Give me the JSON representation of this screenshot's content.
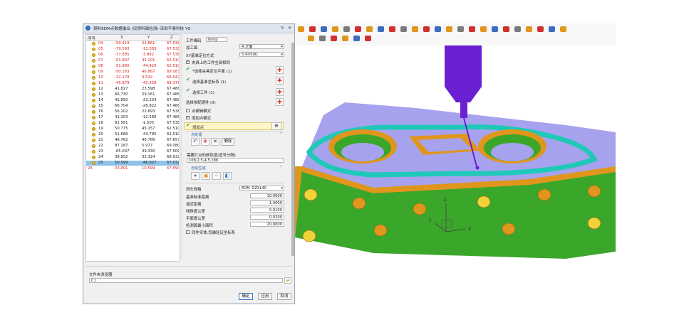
{
  "window": {
    "title": "铜料EDM点数据输出 (仅铜料面检测)-深圳平泰科技 YG"
  },
  "table": {
    "headers": [
      "序号",
      "X",
      "Y",
      "Z"
    ],
    "rows": [
      {
        "n": "",
        "id": "04",
        "x": "-59.419",
        "y": "22.861",
        "z": "67.538",
        "color": "red"
      },
      {
        "n": "",
        "id": "05",
        "x": "-79.593",
        "y": "-11.383",
        "z": "67.538",
        "color": "red"
      },
      {
        "n": "",
        "id": "06",
        "x": "-37.685",
        "y": "-3.882",
        "z": "67.538",
        "color": "red"
      },
      {
        "n": "",
        "id": "07",
        "x": "-51.807",
        "y": "45.101",
        "z": "62.510",
        "color": "red"
      },
      {
        "n": "",
        "id": "08",
        "x": "-51.860",
        "y": "-44.929",
        "z": "62.510",
        "color": "red"
      },
      {
        "n": "",
        "id": "09",
        "x": "-50.163",
        "y": "46.867",
        "z": "68.083",
        "color": "red"
      },
      {
        "n": "",
        "id": "10",
        "x": "-32.178",
        "y": "0.532",
        "z": "68.547",
        "color": "red"
      },
      {
        "n": "",
        "id": "11",
        "x": "-45.879",
        "y": "-45.358",
        "z": "68.378",
        "color": "red"
      },
      {
        "n": "",
        "id": "12",
        "x": "41.827",
        "y": "23.598",
        "z": "67.488",
        "color": "dark"
      },
      {
        "n": "",
        "id": "13",
        "x": "66.730",
        "y": "29.161",
        "z": "67.488",
        "color": "dark"
      },
      {
        "n": "",
        "id": "14",
        "x": "41.850",
        "y": "-23.234",
        "z": "67.488",
        "color": "dark"
      },
      {
        "n": "",
        "id": "15",
        "x": "66.704",
        "y": "-28.822",
        "z": "67.488",
        "color": "dark"
      },
      {
        "n": "",
        "id": "16",
        "x": "56.202",
        "y": "22.693",
        "z": "67.538",
        "color": "dark"
      },
      {
        "n": "",
        "id": "17",
        "x": "41.303",
        "y": "-12.586",
        "z": "67.488",
        "color": "dark"
      },
      {
        "n": "",
        "id": "18",
        "x": "82.581",
        "y": "-1.505",
        "z": "67.538",
        "color": "dark"
      },
      {
        "n": "",
        "id": "19",
        "x": "50.775",
        "y": "45.157",
        "z": "62.510",
        "color": "dark"
      },
      {
        "n": "",
        "id": "20",
        "x": "51.686",
        "y": "-44.785",
        "z": "62.510",
        "color": "dark"
      },
      {
        "n": "",
        "id": "21",
        "x": "48.762",
        "y": "46.786",
        "z": "67.657",
        "color": "dark"
      },
      {
        "n": "",
        "id": "22",
        "x": "87.187",
        "y": "5.977",
        "z": "69.080",
        "color": "dark"
      },
      {
        "n": "",
        "id": "23",
        "x": "-65.037",
        "y": "39.330",
        "z": "67.509",
        "color": "dark"
      },
      {
        "n": "",
        "id": "24",
        "x": "38.852",
        "y": "32.324",
        "z": "68.632",
        "color": "dark"
      },
      {
        "n": "",
        "id": "25",
        "x": "50.599",
        "y": "-46.927",
        "z": "67.032",
        "color": "sel"
      },
      {
        "n": "26",
        "id": "",
        "x": "33.891",
        "y": "10.599",
        "z": "67.890",
        "color": "red"
      }
    ]
  },
  "panel": {
    "workpiece_no_label": "工件编码",
    "workpiece_no_value": "temp",
    "machining_face_label": "加工面",
    "machining_face_value": "A:正面",
    "xy_ref_label": "XY基准定位方式",
    "xy_ref_value": "5:中(5点)",
    "fixture_same_label": "夹具上的工件全部相同",
    "select_fixture_plane": "*选择夹具定位平面 (1)",
    "select_ref_csys": "选择基准坐标系 (1)",
    "select_workpiece": "选择工件 (1)",
    "select_ref_group_label": "选择参配铜件 (0)",
    "mode_probe": "点编辑模式",
    "mode_add": "增加点模式",
    "add_point": "增加点",
    "point_process_section": "点处理",
    "delete_label": "删除",
    "color_prompt": "需要打点的颜色值(逗号分隔)",
    "color_value": "108,2,5,4,5,186",
    "auto_gen_section": "自动生成",
    "probe_spec_label": "测头规格",
    "probe_spec_value": "EDM_DZXL40",
    "safe_dist_label": "基准标准距离",
    "safe_dist_value": "10.0000",
    "approach_label": "逼近距离",
    "approach_value": "1.0000",
    "tilt_tol_label": "倾斜度公差",
    "tilt_tol_value": "0.0100",
    "flat_tol_label": "平面度公差",
    "flat_tol_value": "0.0200",
    "min_area_label": "检测面最小面积",
    "min_area_value": "20.0000",
    "one_csys_label": "同件实体,您确验证坐标系"
  },
  "bottom": {
    "folder_label": "文件夹浏览器",
    "folder_value": "C:\\",
    "ok_label": "确定",
    "apply_label": "应用",
    "cancel_label": "取消"
  },
  "viewport": {
    "axis_x": "X",
    "axis_y": "Y",
    "axis_z": "Z"
  },
  "colors": {
    "mold_green": "#3aa62a",
    "mold_purple": "#a7a2ee",
    "mold_orange": "#e0961c",
    "cyan_channel": "#20c8b8",
    "probe_purple": "#6a1fd0",
    "selection_blue": "#8fc3e8"
  }
}
